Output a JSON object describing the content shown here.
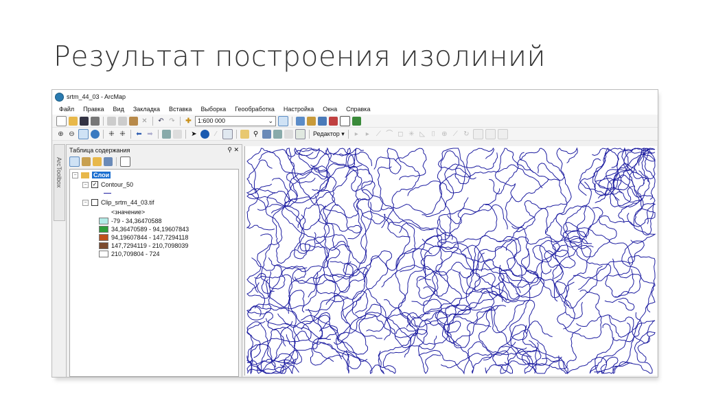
{
  "slide": {
    "title": "Результат построения изолиний"
  },
  "window": {
    "title": "srtm_44_03 - ArcMap"
  },
  "menu": [
    "Файл",
    "Правка",
    "Вид",
    "Закладка",
    "Вставка",
    "Выборка",
    "Геообработка",
    "Настройка",
    "Окна",
    "Справка"
  ],
  "toolbar": {
    "scale": "1:600 000",
    "editor_label": "Редактор ▾"
  },
  "toolbox_tab": "ArcToolbox",
  "toc": {
    "title": "Таблица содержания",
    "group": "Слои",
    "layer1": "Contour_50",
    "layer1_checked": true,
    "layer2": "Clip_srtm_44_03.tif",
    "layer2_checked": false,
    "value_label": "<значение>",
    "legend": [
      {
        "label": "-79 - 34,36470588",
        "color": "#b2ebe6"
      },
      {
        "label": "34,36470589 - 94,19607843",
        "color": "#2e9e3a"
      },
      {
        "label": "94,19607844 - 147,7294118",
        "color": "#c0501a"
      },
      {
        "label": "147,7294119 - 210,7098039",
        "color": "#7b4a2e"
      },
      {
        "label": "210,709804 - 724",
        "color": "#ffffff"
      }
    ]
  },
  "map": {
    "line_color": "#1c1ca0"
  }
}
